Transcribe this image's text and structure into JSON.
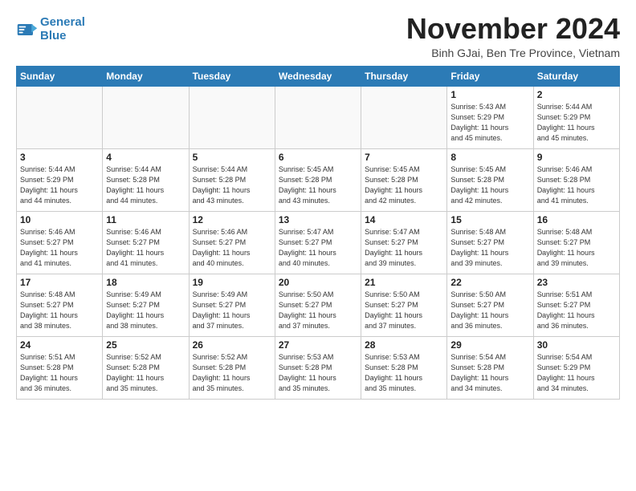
{
  "logo": {
    "line1": "General",
    "line2": "Blue"
  },
  "title": "November 2024",
  "location": "Binh GJai, Ben Tre Province, Vietnam",
  "weekdays": [
    "Sunday",
    "Monday",
    "Tuesday",
    "Wednesday",
    "Thursday",
    "Friday",
    "Saturday"
  ],
  "weeks": [
    [
      {
        "day": "",
        "info": ""
      },
      {
        "day": "",
        "info": ""
      },
      {
        "day": "",
        "info": ""
      },
      {
        "day": "",
        "info": ""
      },
      {
        "day": "",
        "info": ""
      },
      {
        "day": "1",
        "info": "Sunrise: 5:43 AM\nSunset: 5:29 PM\nDaylight: 11 hours\nand 45 minutes."
      },
      {
        "day": "2",
        "info": "Sunrise: 5:44 AM\nSunset: 5:29 PM\nDaylight: 11 hours\nand 45 minutes."
      }
    ],
    [
      {
        "day": "3",
        "info": "Sunrise: 5:44 AM\nSunset: 5:29 PM\nDaylight: 11 hours\nand 44 minutes."
      },
      {
        "day": "4",
        "info": "Sunrise: 5:44 AM\nSunset: 5:28 PM\nDaylight: 11 hours\nand 44 minutes."
      },
      {
        "day": "5",
        "info": "Sunrise: 5:44 AM\nSunset: 5:28 PM\nDaylight: 11 hours\nand 43 minutes."
      },
      {
        "day": "6",
        "info": "Sunrise: 5:45 AM\nSunset: 5:28 PM\nDaylight: 11 hours\nand 43 minutes."
      },
      {
        "day": "7",
        "info": "Sunrise: 5:45 AM\nSunset: 5:28 PM\nDaylight: 11 hours\nand 42 minutes."
      },
      {
        "day": "8",
        "info": "Sunrise: 5:45 AM\nSunset: 5:28 PM\nDaylight: 11 hours\nand 42 minutes."
      },
      {
        "day": "9",
        "info": "Sunrise: 5:46 AM\nSunset: 5:28 PM\nDaylight: 11 hours\nand 41 minutes."
      }
    ],
    [
      {
        "day": "10",
        "info": "Sunrise: 5:46 AM\nSunset: 5:27 PM\nDaylight: 11 hours\nand 41 minutes."
      },
      {
        "day": "11",
        "info": "Sunrise: 5:46 AM\nSunset: 5:27 PM\nDaylight: 11 hours\nand 41 minutes."
      },
      {
        "day": "12",
        "info": "Sunrise: 5:46 AM\nSunset: 5:27 PM\nDaylight: 11 hours\nand 40 minutes."
      },
      {
        "day": "13",
        "info": "Sunrise: 5:47 AM\nSunset: 5:27 PM\nDaylight: 11 hours\nand 40 minutes."
      },
      {
        "day": "14",
        "info": "Sunrise: 5:47 AM\nSunset: 5:27 PM\nDaylight: 11 hours\nand 39 minutes."
      },
      {
        "day": "15",
        "info": "Sunrise: 5:48 AM\nSunset: 5:27 PM\nDaylight: 11 hours\nand 39 minutes."
      },
      {
        "day": "16",
        "info": "Sunrise: 5:48 AM\nSunset: 5:27 PM\nDaylight: 11 hours\nand 39 minutes."
      }
    ],
    [
      {
        "day": "17",
        "info": "Sunrise: 5:48 AM\nSunset: 5:27 PM\nDaylight: 11 hours\nand 38 minutes."
      },
      {
        "day": "18",
        "info": "Sunrise: 5:49 AM\nSunset: 5:27 PM\nDaylight: 11 hours\nand 38 minutes."
      },
      {
        "day": "19",
        "info": "Sunrise: 5:49 AM\nSunset: 5:27 PM\nDaylight: 11 hours\nand 37 minutes."
      },
      {
        "day": "20",
        "info": "Sunrise: 5:50 AM\nSunset: 5:27 PM\nDaylight: 11 hours\nand 37 minutes."
      },
      {
        "day": "21",
        "info": "Sunrise: 5:50 AM\nSunset: 5:27 PM\nDaylight: 11 hours\nand 37 minutes."
      },
      {
        "day": "22",
        "info": "Sunrise: 5:50 AM\nSunset: 5:27 PM\nDaylight: 11 hours\nand 36 minutes."
      },
      {
        "day": "23",
        "info": "Sunrise: 5:51 AM\nSunset: 5:27 PM\nDaylight: 11 hours\nand 36 minutes."
      }
    ],
    [
      {
        "day": "24",
        "info": "Sunrise: 5:51 AM\nSunset: 5:28 PM\nDaylight: 11 hours\nand 36 minutes."
      },
      {
        "day": "25",
        "info": "Sunrise: 5:52 AM\nSunset: 5:28 PM\nDaylight: 11 hours\nand 35 minutes."
      },
      {
        "day": "26",
        "info": "Sunrise: 5:52 AM\nSunset: 5:28 PM\nDaylight: 11 hours\nand 35 minutes."
      },
      {
        "day": "27",
        "info": "Sunrise: 5:53 AM\nSunset: 5:28 PM\nDaylight: 11 hours\nand 35 minutes."
      },
      {
        "day": "28",
        "info": "Sunrise: 5:53 AM\nSunset: 5:28 PM\nDaylight: 11 hours\nand 35 minutes."
      },
      {
        "day": "29",
        "info": "Sunrise: 5:54 AM\nSunset: 5:28 PM\nDaylight: 11 hours\nand 34 minutes."
      },
      {
        "day": "30",
        "info": "Sunrise: 5:54 AM\nSunset: 5:29 PM\nDaylight: 11 hours\nand 34 minutes."
      }
    ]
  ]
}
